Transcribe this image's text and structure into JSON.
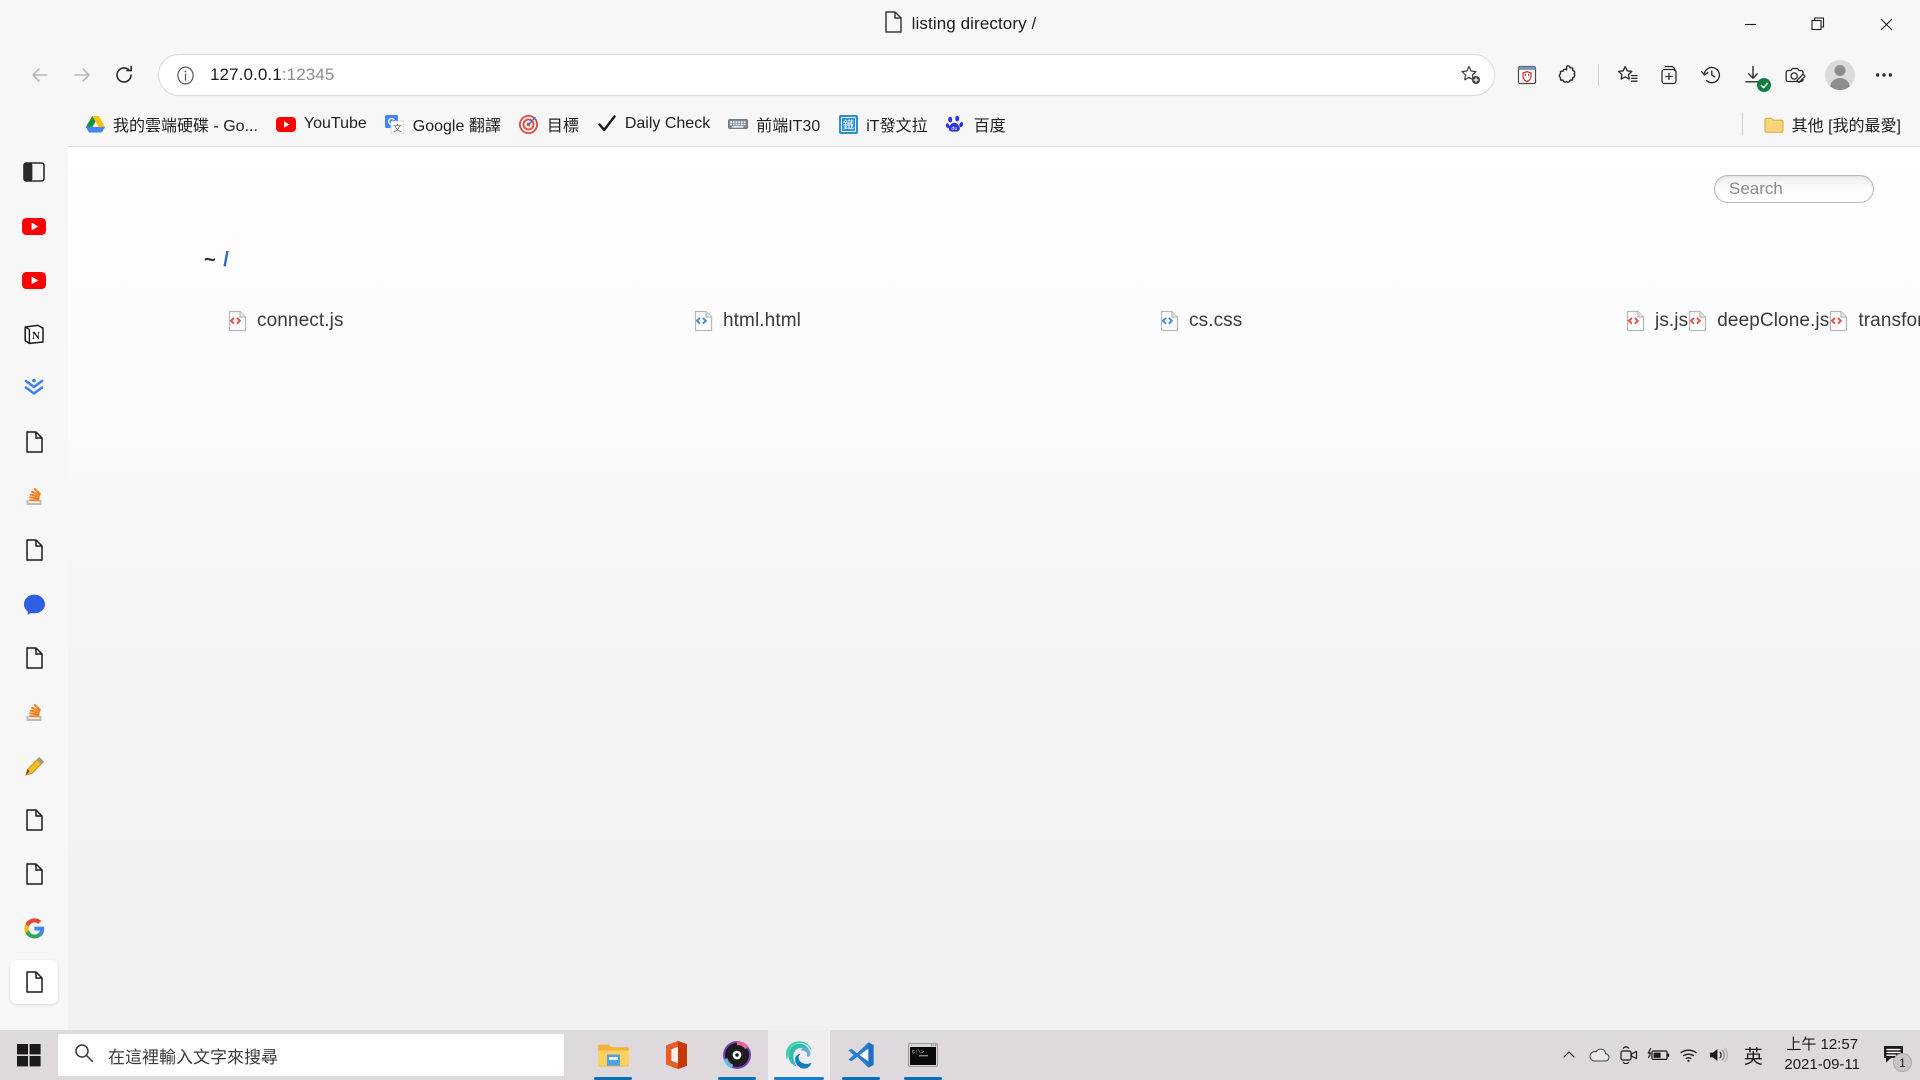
{
  "window": {
    "tab_title": "listing directory /",
    "controls": {
      "minimize": "—",
      "maximize": "❐",
      "close": "✕"
    }
  },
  "toolbar": {
    "back_label": "Back",
    "forward_label": "Forward",
    "refresh_label": "Refresh",
    "url": "127.0.0.1",
    "url_port": ":12345",
    "favorite_label": "Add this page to favorites",
    "extension_label": "Extension",
    "extensions_label": "Extensions",
    "favorites_label": "Favorites",
    "collections_label": "Collections",
    "history_label": "History",
    "downloads_label": "Downloads",
    "webcapture_label": "Web capture",
    "profile_label": "Profile",
    "settings_label": "Settings and more"
  },
  "bookmarks": {
    "items": [
      {
        "label": "我的雲端硬碟 - Go...",
        "icon": "google-drive-icon"
      },
      {
        "label": "YouTube",
        "icon": "youtube-icon"
      },
      {
        "label": "Google 翻譯",
        "icon": "google-translate-icon"
      },
      {
        "label": "目標",
        "icon": "target-icon"
      },
      {
        "label": "Daily Check",
        "icon": "checkmark-icon"
      },
      {
        "label": "前端IT30",
        "icon": "keyboard-icon"
      },
      {
        "label": "iT發文拉",
        "icon": "ithome-icon"
      },
      {
        "label": "百度",
        "icon": "baidu-icon"
      }
    ],
    "other_folder": "其他 [我的最愛]"
  },
  "vertical_tabs": {
    "toggle_label": "Tab actions menu",
    "items": [
      {
        "icon": "youtube-icon",
        "name": "youtube"
      },
      {
        "icon": "youtube-icon",
        "name": "youtube"
      },
      {
        "icon": "notion-icon",
        "name": "notion"
      },
      {
        "icon": "double-chevron-down-icon",
        "name": "downloads-site"
      },
      {
        "icon": "document-icon",
        "name": "document"
      },
      {
        "icon": "stackoverflow-icon",
        "name": "stackoverflow"
      },
      {
        "icon": "document-icon",
        "name": "document"
      },
      {
        "icon": "messenger-icon",
        "name": "messenger"
      },
      {
        "icon": "document-icon",
        "name": "document"
      },
      {
        "icon": "stackoverflow-icon",
        "name": "stackoverflow"
      },
      {
        "icon": "pencil-icon",
        "name": "editor"
      },
      {
        "icon": "document-icon",
        "name": "document"
      },
      {
        "icon": "document-icon",
        "name": "document"
      },
      {
        "icon": "google-icon",
        "name": "google"
      },
      {
        "icon": "document-icon",
        "name": "listing-directory",
        "active": true
      }
    ],
    "new_tab_label": "+"
  },
  "page": {
    "search_placeholder": "Search",
    "breadcrumb_home": "~",
    "breadcrumb_sep": "/",
    "files": [
      {
        "name": "connect.js",
        "type": "js",
        "icon": "code-file-red-icon"
      },
      {
        "name": "html.html",
        "type": "html",
        "icon": "code-file-blue-icon"
      },
      {
        "name": "cs.css",
        "type": "css",
        "icon": "code-file-blue-icon"
      },
      {
        "name": "js.js",
        "type": "js",
        "icon": "code-file-red-icon"
      },
      {
        "name": "deepClone.js",
        "type": "js",
        "icon": "code-file-red-icon"
      },
      {
        "name": "transform.js",
        "type": "js",
        "icon": "code-file-red-icon"
      }
    ]
  },
  "taskbar": {
    "start_label": "Start",
    "search_placeholder": "在這裡輸入文字來搜尋",
    "apps": [
      {
        "name": "file-explorer",
        "running": true,
        "active": false
      },
      {
        "name": "microsoft-office",
        "running": false,
        "active": false
      },
      {
        "name": "media-player",
        "running": true,
        "active": false
      },
      {
        "name": "microsoft-edge",
        "running": true,
        "active": true
      },
      {
        "name": "visual-studio-code",
        "running": true,
        "active": false
      },
      {
        "name": "command-prompt",
        "running": true,
        "active": false
      }
    ],
    "tray": {
      "overflow_label": "Show hidden icons",
      "onedrive_label": "OneDrive",
      "meet_label": "Camera",
      "battery_label": "Battery",
      "network_label": "Network",
      "volume_label": "Volume",
      "ime_label": "英",
      "time": "上午 12:57",
      "date": "2021-09-11",
      "notification_count": "1"
    }
  },
  "colors": {
    "accent": "#0a6ebd",
    "taskbar_bg": "#ddd9dc",
    "chrome_bg": "#f7f7f7",
    "js_red": "#e8524f",
    "html_blue": "#3f8fdb",
    "download_green": "#107c41"
  }
}
